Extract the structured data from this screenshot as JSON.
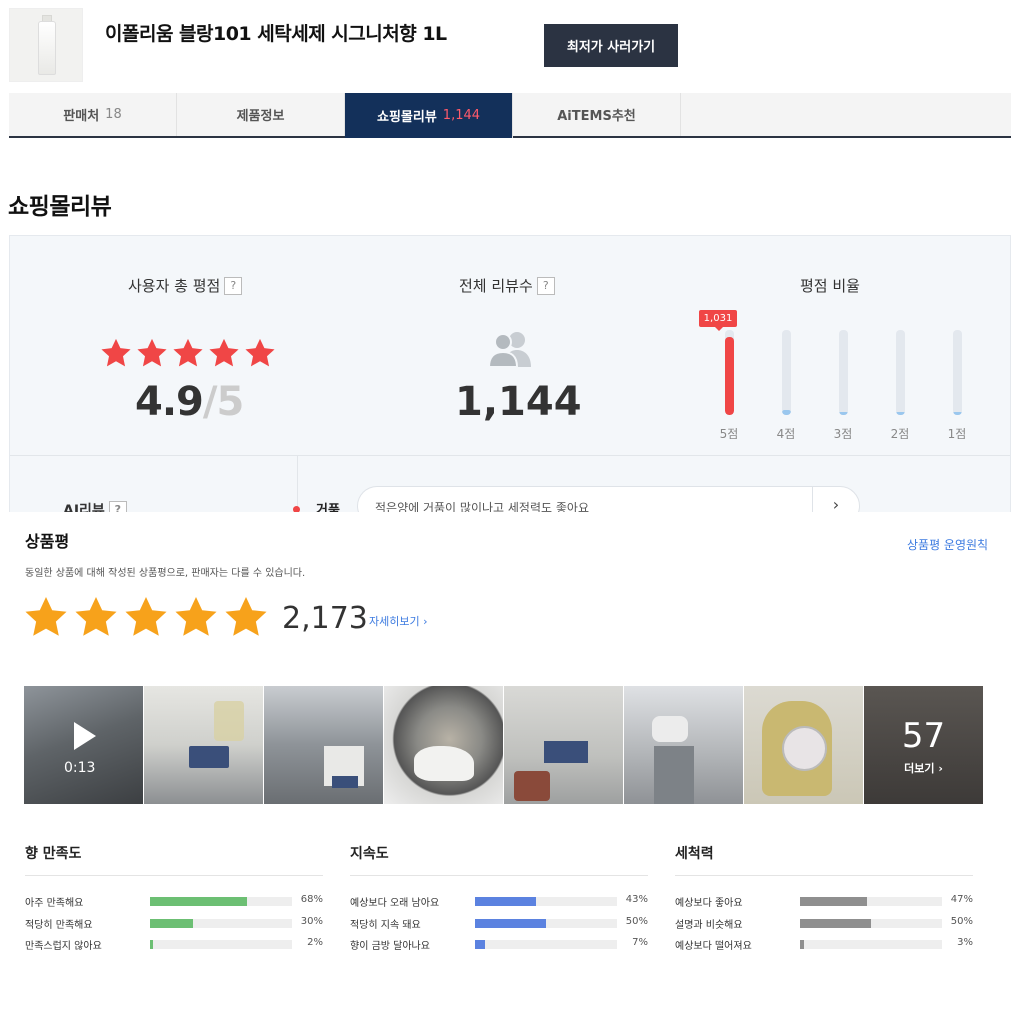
{
  "product": {
    "title": "이폴리움 블랑101 세탁세제 시그니처향 1L",
    "lowest_button": "최저가 사러가기"
  },
  "tabs": [
    {
      "label": "판매처",
      "count": "18",
      "active": false
    },
    {
      "label": "제품정보",
      "count": "",
      "active": false
    },
    {
      "label": "쇼핑몰리뷰",
      "count": "1,144",
      "active": true
    },
    {
      "label": "AiTEMS추천",
      "count": "",
      "active": false
    }
  ],
  "section_title": "쇼핑몰리뷰",
  "summary": {
    "rating_label": "사용자 총 평점",
    "rating": "4.9",
    "rating_max": "/5",
    "rating_stars": 5,
    "count_label": "전체 리뷰수",
    "count": "1,144",
    "ratio_label": "평점 비율",
    "ratio_bars": [
      {
        "label": "5점",
        "value": 1031,
        "badge": "1,031"
      },
      {
        "label": "4점",
        "value": 70
      },
      {
        "label": "3점",
        "value": 15
      },
      {
        "label": "2점",
        "value": 8
      },
      {
        "label": "1점",
        "value": 10
      }
    ],
    "help_mark": "?"
  },
  "ai_review": {
    "label": "AI리뷰",
    "tag": "거품",
    "text": "적은양에 거품이 많이나고 세정력도 좋아요",
    "next": "›"
  },
  "product_review": {
    "title": "상품평",
    "policy_link": "상품평 운영원칙",
    "description": "동일한 상품에 대해 작성된 상품평으로, 판매자는 다를 수 있습니다.",
    "stars": 5,
    "count": "2,173",
    "more_link": "자세히보기 ›",
    "video_duration": "0:13",
    "photo_more_count": "57",
    "photo_more_label": "더보기 ›"
  },
  "metrics": [
    {
      "title": "향 만족도",
      "color": "#6cbf73",
      "rows": [
        {
          "label": "아주 만족해요",
          "pct": 68,
          "pct_label": "68%"
        },
        {
          "label": "적당히 만족해요",
          "pct": 30,
          "pct_label": "30%"
        },
        {
          "label": "만족스럽지 않아요",
          "pct": 2,
          "pct_label": "2%"
        }
      ]
    },
    {
      "title": "지속도",
      "color": "#5b82e0",
      "rows": [
        {
          "label": "예상보다 오래 남아요",
          "pct": 43,
          "pct_label": "43%"
        },
        {
          "label": "적당히 지속 돼요",
          "pct": 50,
          "pct_label": "50%"
        },
        {
          "label": "향이 금방 달아나요",
          "pct": 7,
          "pct_label": "7%"
        }
      ]
    },
    {
      "title": "세척력",
      "color": "#8f8f8f",
      "rows": [
        {
          "label": "예상보다 좋아요",
          "pct": 47,
          "pct_label": "47%"
        },
        {
          "label": "설명과 비슷해요",
          "pct": 50,
          "pct_label": "50%"
        },
        {
          "label": "예상보다 떨어져요",
          "pct": 3,
          "pct_label": "3%"
        }
      ]
    }
  ],
  "colors": {
    "accent_dark": "#2b3342",
    "tab_active": "#13305a",
    "star_red": "#f04646",
    "star_orange": "#f7a21b",
    "link_blue": "#3d7be0"
  }
}
